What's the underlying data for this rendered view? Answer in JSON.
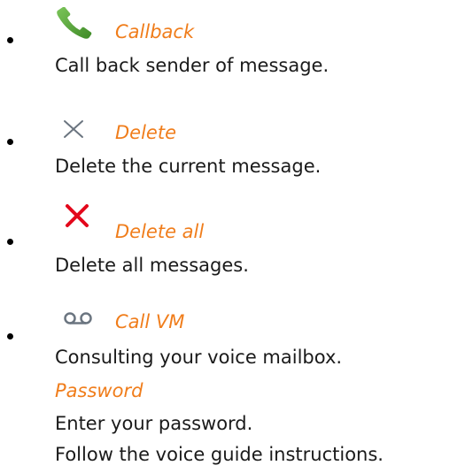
{
  "items": [
    {
      "icon": "phone-handset-icon",
      "title": "Callback",
      "description": "Call back sender of message."
    },
    {
      "icon": "thin-cross-icon",
      "title": "Delete",
      "description": "Delete the current message."
    },
    {
      "icon": "red-cross-icon",
      "title": "Delete all",
      "description": "Delete all messages."
    },
    {
      "icon": "voicemail-icon",
      "title": "Call VM",
      "description": "Consulting your voice mailbox.",
      "subtitle": "Password",
      "line3": "Enter your password.",
      "line4": "Follow the voice guide instructions."
    }
  ],
  "colors": {
    "title": "#f07d1b",
    "body_text": "#1a1a1a",
    "phone_green": "#5aa83c",
    "red_cross": "#e3071b",
    "gray_icon": "#6b7580"
  }
}
